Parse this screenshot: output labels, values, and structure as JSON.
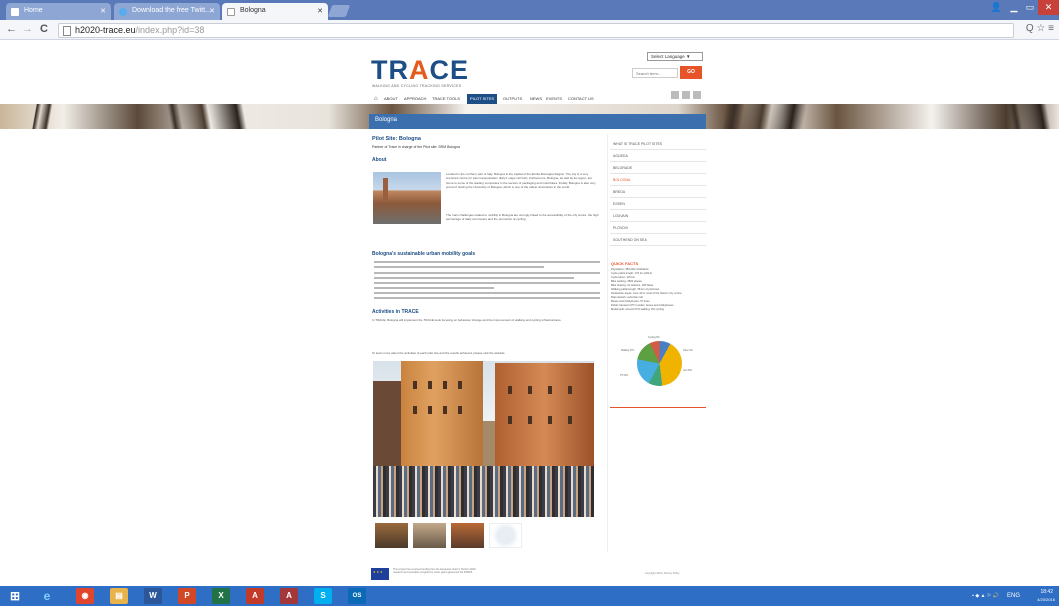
{
  "browser": {
    "tabs": [
      {
        "label": "Home",
        "active": false
      },
      {
        "label": "Download the free Twitt...",
        "active": false
      },
      {
        "label": "Bologna",
        "active": true
      }
    ],
    "url_host": "h2020-trace.eu",
    "url_path": "/index.php?id=38",
    "back": "←",
    "forward": "→",
    "reload": "C",
    "tools": "Q ☆ ≡",
    "win_min": "▁",
    "win_max": "▭",
    "win_close": "✕",
    "user": "👤"
  },
  "site": {
    "logo_pre": "TR",
    "logo_a": "A",
    "logo_post": "CE",
    "tagline": "WALKING AND CYCLING TRACKING SERVICES",
    "language": "Select Language ▼",
    "search_placeholder": "Search term...",
    "go_label": "GO",
    "nav": [
      "ABOUT",
      "APPROACH",
      "TRACE TOOLS",
      "PILOT SITES",
      "OUTPUTS",
      "NEWS",
      "EVENTS",
      "CONTACT US"
    ],
    "home_icon": "⌂",
    "nav_active_index": 3
  },
  "page": {
    "banner_title": "Bologna",
    "heading": "Pilot Site: Bologna",
    "partner_line": "Partner of Trace in charge of the Pilot site: SRM Bologna",
    "about_heading": "About",
    "about_text": "Located in the northern part of Italy, Bologna is the capital of the Emilia-Romagna Region. The city is a very important centre for train transportation (Italy’s major rail hub). Furthermore, Bologna, as well as its region, are home to some of the leading companies in the sectors of packaging and motorbikes. Finally, Bologna is also very proud of hosting the University of Bologna, which is one of the oldest universities in the world.",
    "about_text2": "The main challenges related to mobility in Bologna are strongly linked to the accessibility of the city centre, the high percentage of daily commuters and the promotion of cycling.",
    "goals_heading": "Bologna’s sustainable urban mobility goals",
    "activities_heading": "Activities in TRACE",
    "activities_text": "In TRACE, Bologna will implement the TRACE tools focusing on behaviour change and the improvement of walking and cycling infrastructures.",
    "closing_text": "To learn more about the activities of each pilot site and the results achieved, please visit the website."
  },
  "sidebar": {
    "items": [
      "WHAT IS TRACE PILOT SITES",
      "AGUEDA",
      "BELGRADE",
      "BOLOGNA",
      "BREDA",
      "ESSEN",
      "LOUVAIN",
      "PLOVDIV",
      "SOUTHEND ON SEA"
    ],
    "active_index": 3,
    "quick_facts_title": "QUICK FACTS",
    "quick_facts": [
      "Population: 384,202 inhabitants",
      "Cycle paths length: 176 km (2014)",
      "Cycle lanes: 115 km",
      "Bike parking: 4500 places",
      "Bike sharing: 21 stations, 180 bikes",
      "Walking paths length: 38 km of porticoes",
      "Pedestrian areas: zone 30 in most of the historic city centre",
      "Rail network: suburban rail",
      "Buses and trolleybuses: 57 lines",
      "Public transport (PT) modes: buses and trolleybuses",
      "Modal split: around 27% walking, 9% cycling"
    ],
    "pie_labels": [
      "Walking 27%",
      "Cycling 9%",
      "Car 40%",
      "PT 20%",
      "Other 4%"
    ],
    "pie_colors": [
      "#4b7fc1",
      "#f0b400",
      "#3fa57d",
      "#46aee0",
      "#5ca042",
      "#d35b45"
    ]
  },
  "footer": {
    "eu_text": "This project has received funding from the European Union’s Horizon 2020 research and innovation programme under grant agreement No 635266",
    "copyright": "Copyright 2016 | Privacy Policy"
  },
  "taskbar": {
    "apps": [
      "⊞",
      "e",
      "◉",
      "▤",
      "W",
      "P",
      "X",
      "A",
      "A",
      "S",
      "OS"
    ],
    "tray_lang": "ENG",
    "time": "18:42",
    "date": "4/20/2016"
  }
}
